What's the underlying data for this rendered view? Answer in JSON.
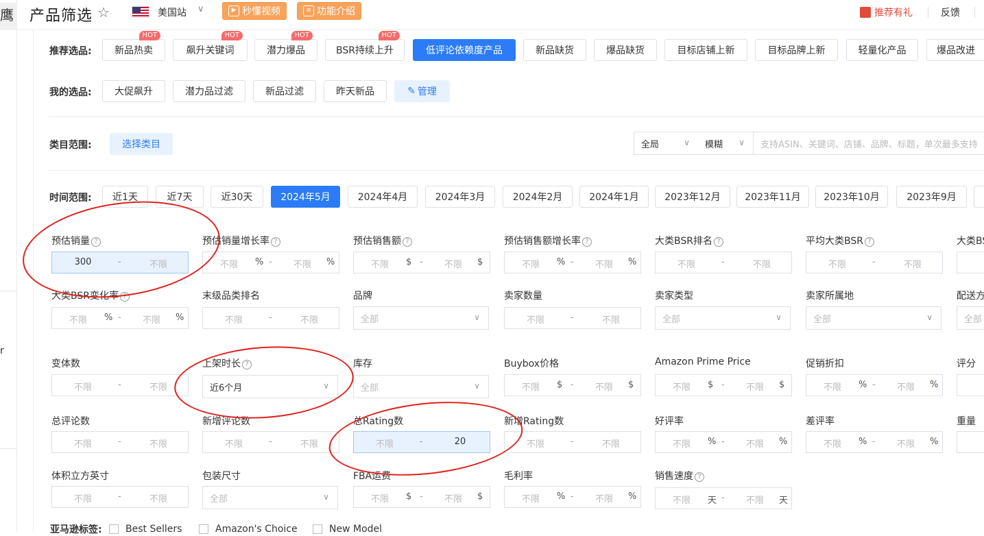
{
  "left_strip": {
    "cut_char": "鹰",
    "letter": "r"
  },
  "header": {
    "title": "产品筛选",
    "site": "美国站",
    "video_btn": "秒懂视频",
    "intro_btn": "功能介绍",
    "gift": "推荐有礼",
    "feedback": "反馈"
  },
  "recommend": {
    "label": "推荐选品:",
    "hot": "HOT",
    "items": [
      "新品热卖",
      "飙升关键词",
      "潜力爆品",
      "BSR持续上升",
      "低评论依赖度产品",
      "新品缺货",
      "爆品缺货",
      "目标店铺上新",
      "目标品牌上新",
      "轻量化产品",
      "爆品改进"
    ]
  },
  "mine": {
    "label": "我的选品:",
    "items": [
      "大促飙升",
      "潜力品过滤",
      "新品过滤",
      "昨天新品"
    ],
    "manage": "管理"
  },
  "category": {
    "label": "类目范围:",
    "button": "选择类目",
    "scope": "全局",
    "match": "模糊",
    "placeholder": "支持ASIN、关键词、店铺、品牌、标题，单次最多支持"
  },
  "time": {
    "label": "时间范围:",
    "items": [
      "近1天",
      "近7天",
      "近30天",
      "2024年5月",
      "2024年4月",
      "2024年3月",
      "2024年2月",
      "2024年1月",
      "2023年12月",
      "2023年11月",
      "2023年10月",
      "2023年9月"
    ]
  },
  "filters": {
    "unlimited": "不限",
    "all": "全部",
    "dash": "-",
    "r1": [
      "预估销量",
      "预估销量增长率",
      "预估销售额",
      "预估销售额增长率",
      "大类BSR排名",
      "平均大类BSR",
      "大类BSR"
    ],
    "r2": [
      "大类BSR变化率",
      "末级品类排名",
      "品牌",
      "卖家数量",
      "卖家类型",
      "卖家所属地",
      "配送方式"
    ],
    "r3": [
      "变体数",
      "上架时长",
      "库存",
      "Buybox价格",
      "Amazon Prime Price",
      "促销折扣",
      "评分"
    ],
    "r4": [
      "总评论数",
      "新增评论数",
      "总Rating数",
      "新增Rating数",
      "好评率",
      "差评率",
      "重量"
    ],
    "r5": [
      "体积立方英寸",
      "包装尺寸",
      "FBA运费",
      "毛利率",
      "销售速度"
    ],
    "sales_min": "300",
    "listing_age": "近6个月",
    "rating_max": "20",
    "units": {
      "pct": "%",
      "usd": "$",
      "day": "天"
    }
  },
  "amazon_tags": {
    "label": "亚马逊标签:",
    "items": [
      "Best Sellers",
      "Amazon's Choice",
      "New Model"
    ]
  }
}
